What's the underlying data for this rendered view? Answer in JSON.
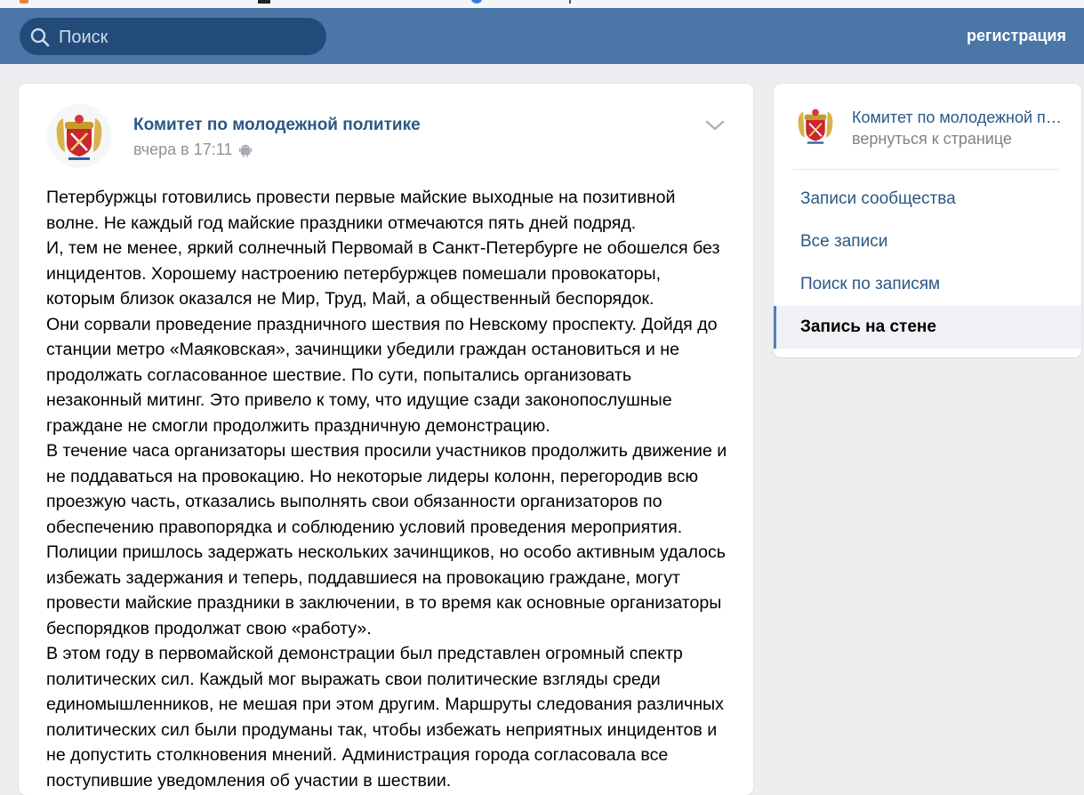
{
  "header": {
    "search": {
      "placeholder": "Поиск"
    },
    "register_label": "регистрация"
  },
  "post": {
    "author": "Комитет по молодежной политике",
    "date": "вчера в 17:11",
    "paragraphs": [
      "Петербуржцы готовились провести первые майские выходные на позитивной волне. Не каждый год майские праздники отмечаются пять дней подряд.",
      "И, тем не менее, яркий солнечный Первомай в Санкт-Петербурге не обошелся без инцидентов. Хорошему настроению петербуржцев помешали провокаторы, которым близок оказался не Мир, Труд, Май, а общественный беспорядок.",
      "Они сорвали проведение праздничного шествия по Невскому проспекту. Дойдя до станции метро «Маяковская», зачинщики убедили граждан остановиться и не продолжать согласованное шествие. По сути, попытались организовать незаконный митинг. Это привело к тому, что идущие сзади законопослушные граждане не смогли продолжить праздничную демонстрацию.",
      "В течение часа организаторы шествия просили участников продолжить движение и не поддаваться на провокацию. Но некоторые лидеры колонн, перегородив всю проезжую часть, отказались выполнять свои обязанности организаторов по обеспечению правопорядка и соблюдению условий проведения мероприятия.",
      "Полиции пришлось задержать нескольких зачинщиков, но особо активным удалось избежать задержания и теперь, поддавшиеся на провокацию граждане, могут провести майские праздники в заключении, в то время как основные организаторы беспорядков продолжат свою «работу».",
      "В этом году в первомайской демонстрации был представлен огромный спектр политических сил. Каждый мог выражать свои политические взгляды среди единомышленников, не мешая при этом другим. Маршруты следования различных политических сил были продуманы так, чтобы избежать неприятных инцидентов и не допустить столкновения мнений. Администрация города согласовала все поступившие уведомления об участии в шествии."
    ]
  },
  "sidebar": {
    "group_name": "Комитет по молодежной политике",
    "back_label": "вернуться к странице",
    "menu": [
      {
        "label": "Записи сообщества"
      },
      {
        "label": "Все записи"
      },
      {
        "label": "Поиск по записям"
      },
      {
        "label": "Запись на стене"
      }
    ]
  },
  "colors": {
    "header_bg": "#4a76a8",
    "search_bg": "#224b7a",
    "link": "#2a5885",
    "page_bg": "#edeef0"
  },
  "icons": [
    "search-icon",
    "chevron-down-icon",
    "android-icon",
    "coat-of-arms-logo"
  ]
}
